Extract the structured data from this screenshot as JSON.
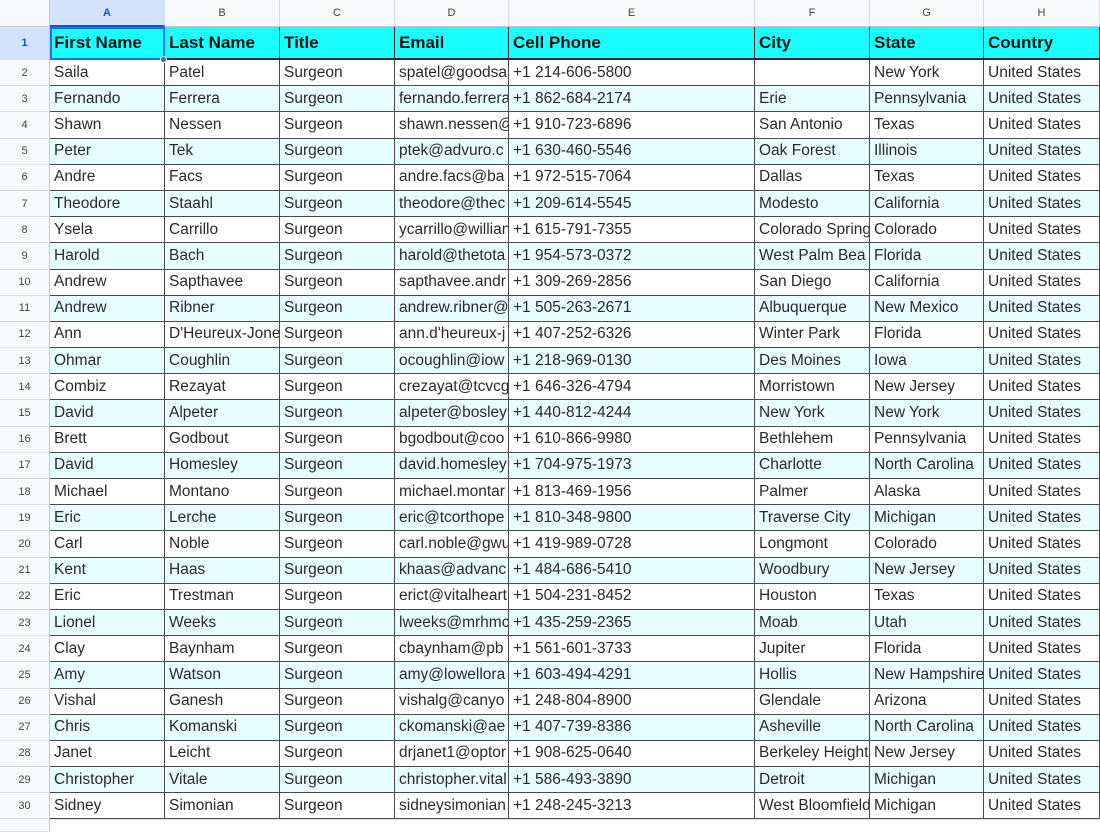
{
  "columns": [
    "A",
    "B",
    "C",
    "D",
    "E",
    "F",
    "G",
    "H"
  ],
  "header": {
    "row_number": "1",
    "cells": [
      "First Name",
      "Last Name",
      "Title",
      "Email",
      "Cell Phone",
      "City",
      "State",
      "Country"
    ]
  },
  "rows": [
    {
      "num": "2",
      "cells": [
        "Saila",
        "Patel",
        "Surgeon",
        "spatel@goodsa",
        "+1 214-606-5800",
        "",
        "New York",
        "United States"
      ]
    },
    {
      "num": "3",
      "cells": [
        "Fernando",
        "Ferrera",
        "Surgeon",
        "fernando.ferrera",
        "+1 862-684-2174",
        "Erie",
        "Pennsylvania",
        "United States"
      ]
    },
    {
      "num": "4",
      "cells": [
        "Shawn",
        "Nessen",
        "Surgeon",
        "shawn.nessen@",
        "+1 910-723-6896",
        "San Antonio",
        "Texas",
        "United States"
      ]
    },
    {
      "num": "5",
      "cells": [
        "Peter",
        "Tek",
        "Surgeon",
        "ptek@advuro.c",
        "+1 630-460-5546",
        "Oak Forest",
        "Illinois",
        "United States"
      ]
    },
    {
      "num": "6",
      "cells": [
        "Andre",
        "Facs",
        "Surgeon",
        "andre.facs@ba",
        "+1 972-515-7064",
        "Dallas",
        "Texas",
        "United States"
      ]
    },
    {
      "num": "7",
      "cells": [
        "Theodore",
        "Staahl",
        "Surgeon",
        "theodore@thec",
        "+1 209-614-5545",
        "Modesto",
        "California",
        "United States"
      ]
    },
    {
      "num": "8",
      "cells": [
        "Ysela",
        "Carrillo",
        "Surgeon",
        "ycarrillo@willian",
        "+1 615-791-7355",
        "Colorado Spring",
        "Colorado",
        "United States"
      ]
    },
    {
      "num": "9",
      "cells": [
        "Harold",
        "Bach",
        "Surgeon",
        "harold@thetota",
        "+1 954-573-0372",
        "West Palm Bea",
        "Florida",
        "United States"
      ]
    },
    {
      "num": "10",
      "cells": [
        "Andrew",
        "Sapthavee",
        "Surgeon",
        "sapthavee.andr",
        "+1 309-269-2856",
        "San Diego",
        "California",
        "United States"
      ]
    },
    {
      "num": "11",
      "cells": [
        "Andrew",
        "Ribner",
        "Surgeon",
        "andrew.ribner@",
        "+1 505-263-2671",
        "Albuquerque",
        "New Mexico",
        "United States"
      ]
    },
    {
      "num": "12",
      "cells": [
        "Ann",
        "D'Heureux-Jone",
        "Surgeon",
        "ann.d'heureux-j",
        "+1 407-252-6326",
        "Winter Park",
        "Florida",
        "United States"
      ]
    },
    {
      "num": "13",
      "cells": [
        "Ohmar",
        "Coughlin",
        "Surgeon",
        "ocoughlin@iow",
        "+1 218-969-0130",
        "Des Moines",
        "Iowa",
        "United States"
      ]
    },
    {
      "num": "14",
      "cells": [
        "Combiz",
        "Rezayat",
        "Surgeon",
        "crezayat@tcvcg",
        "+1 646-326-4794",
        "Morristown",
        "New Jersey",
        "United States"
      ]
    },
    {
      "num": "15",
      "cells": [
        "David",
        "Alpeter",
        "Surgeon",
        "alpeter@bosley",
        "+1 440-812-4244",
        "New York",
        "New York",
        "United States"
      ]
    },
    {
      "num": "16",
      "cells": [
        "Brett",
        "Godbout",
        "Surgeon",
        "bgodbout@coo",
        "+1 610-866-9980",
        "Bethlehem",
        "Pennsylvania",
        "United States"
      ]
    },
    {
      "num": "17",
      "cells": [
        "David",
        "Homesley",
        "Surgeon",
        "david.homesley",
        "+1 704-975-1973",
        "Charlotte",
        "North Carolina",
        "United States"
      ]
    },
    {
      "num": "18",
      "cells": [
        "Michael",
        "Montano",
        "Surgeon",
        "michael.montar",
        "+1 813-469-1956",
        "Palmer",
        "Alaska",
        "United States"
      ]
    },
    {
      "num": "19",
      "cells": [
        "Eric",
        "Lerche",
        "Surgeon",
        "eric@tcorthope",
        "+1 810-348-9800",
        "Traverse City",
        "Michigan",
        "United States"
      ]
    },
    {
      "num": "20",
      "cells": [
        "Carl",
        "Noble",
        "Surgeon",
        "carl.noble@gwu",
        "+1 419-989-0728",
        "Longmont",
        "Colorado",
        "United States"
      ]
    },
    {
      "num": "21",
      "cells": [
        "Kent",
        "Haas",
        "Surgeon",
        "khaas@advanc",
        "+1 484-686-5410",
        "Woodbury",
        "New Jersey",
        "United States"
      ]
    },
    {
      "num": "22",
      "cells": [
        "Eric",
        "Trestman",
        "Surgeon",
        "erict@vitalheart",
        "+1 504-231-8452",
        "Houston",
        "Texas",
        "United States"
      ]
    },
    {
      "num": "23",
      "cells": [
        "Lionel",
        "Weeks",
        "Surgeon",
        "lweeks@mrhmc",
        "+1 435-259-2365",
        "Moab",
        "Utah",
        "United States"
      ]
    },
    {
      "num": "24",
      "cells": [
        "Clay",
        "Baynham",
        "Surgeon",
        "cbaynham@pb",
        "+1 561-601-3733",
        "Jupiter",
        "Florida",
        "United States"
      ]
    },
    {
      "num": "25",
      "cells": [
        "Amy",
        "Watson",
        "Surgeon",
        "amy@lowellora",
        "+1 603-494-4291",
        "Hollis",
        "New Hampshire",
        "United States"
      ]
    },
    {
      "num": "26",
      "cells": [
        "Vishal",
        "Ganesh",
        "Surgeon",
        "vishalg@canyo",
        "+1 248-804-8900",
        "Glendale",
        "Arizona",
        "United States"
      ]
    },
    {
      "num": "27",
      "cells": [
        "Chris",
        "Komanski",
        "Surgeon",
        "ckomanski@ae",
        "+1 407-739-8386",
        "Asheville",
        "North Carolina",
        "United States"
      ]
    },
    {
      "num": "28",
      "cells": [
        "Janet",
        "Leicht",
        "Surgeon",
        "drjanet1@optor",
        "+1 908-625-0640",
        "Berkeley Height",
        "New Jersey",
        "United States"
      ]
    },
    {
      "num": "29",
      "cells": [
        "Christopher",
        "Vitale",
        "Surgeon",
        "christopher.vital",
        "+1 586-493-3890",
        "Detroit",
        "Michigan",
        "United States"
      ]
    },
    {
      "num": "30",
      "cells": [
        "Sidney",
        "Simonian",
        "Surgeon",
        "sidneysimonian",
        "+1 248-245-3213",
        "West Bloomfield",
        "Michigan",
        "United States"
      ]
    }
  ],
  "colors": {
    "header_fill": "#19ffff",
    "band_fill": "#e8fdfd",
    "selection": "#1a73e8"
  }
}
